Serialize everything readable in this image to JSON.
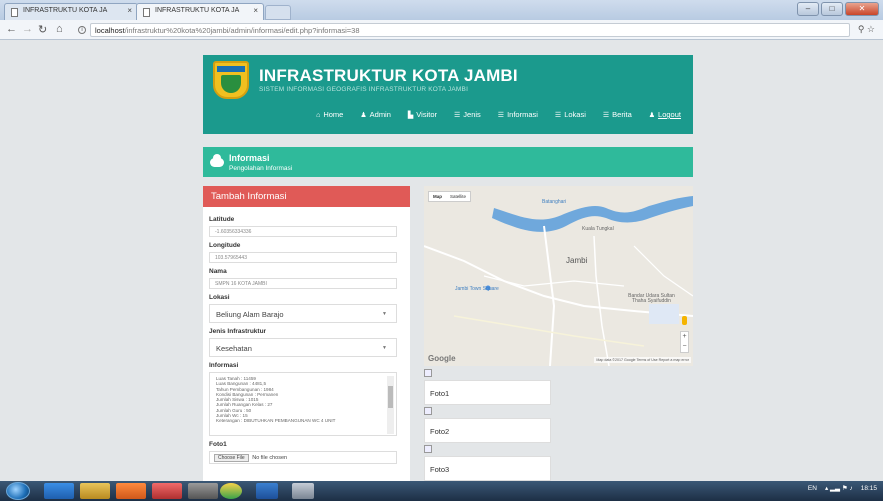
{
  "browser": {
    "tabs": [
      {
        "label": "INFRASTRUKTU KOTA JA",
        "active": false
      },
      {
        "label": "INFRASTRUKTU KOTA JA",
        "active": true
      }
    ],
    "url_host": "localhost",
    "url_path": "/infrastruktur%20kota%20jambi/admin/informasi/edit.php?informasi=38"
  },
  "header": {
    "title": "INFRASTRUKTUR KOTA JAMBI",
    "subtitle": "SISTEM INFORMASI GEOGRAFIS INFRASTRUKTUR KOTA JAMBI",
    "nav": [
      {
        "icon": "home-icon",
        "label": "Home"
      },
      {
        "icon": "user-icon",
        "label": "Admin"
      },
      {
        "icon": "chart-icon",
        "label": "Visitor"
      },
      {
        "icon": "list-icon",
        "label": "Jenis"
      },
      {
        "icon": "list-icon",
        "label": "Informasi"
      },
      {
        "icon": "list-icon",
        "label": "Lokasi"
      },
      {
        "icon": "list-icon",
        "label": "Berita"
      },
      {
        "icon": "user-icon",
        "label": "Logout"
      }
    ]
  },
  "infobar": {
    "title": "Informasi",
    "subtitle": "Pengolahan Informasi"
  },
  "form": {
    "heading": "Tambah Informasi",
    "latitude_label": "Latitude",
    "latitude_value": "-1.60356334336",
    "longitude_label": "Longitude",
    "longitude_value": "103.57965443",
    "nama_label": "Nama",
    "nama_value": "SMPN 16 KOTA JAMBI",
    "lokasi_label": "Lokasi",
    "lokasi_value": "Beliung Alam Barajo",
    "jenis_label": "Jenis Infrastruktur",
    "jenis_value": "Kesehatan",
    "informasi_label": "Informasi",
    "informasi_lines": [
      "Luas Tanah : 11459",
      "Luas Bangunan : 4481,5",
      "Tahun Pembangunan : 1984",
      "Kondisi Bangunan : Permanen",
      "Jumlah Siswa : 1015",
      "Jumlah Ruangan Kelas : 27",
      "Jumlah Guru : 50",
      "Jumlah Wc : 15",
      "Keterangan : DIBUTUHKAN PEMBANGUNAN WC 4 UNIT"
    ],
    "foto1_label": "Foto1",
    "choose_file": "Choose File",
    "no_file": "No file chosen"
  },
  "map": {
    "type_map": "Map",
    "type_satellite": "Satellite",
    "labels": {
      "batanghari": "Batanghari",
      "kuala_tungkal": "Kuala Tungkal",
      "jambi": "Jambi",
      "town_square": "Jambi Town Square",
      "airport": "Bandar Udara Sultan Thaha Syaifuddin"
    },
    "google": "Google",
    "footer": "Map data ©2017 Google   Terms of Use   Report a map error",
    "road_color": "#ffffff",
    "river_color": "#6fa8dc"
  },
  "fotos": [
    "Foto1",
    "Foto2",
    "Foto3"
  ],
  "taskbar": {
    "lang": "EN",
    "time": "18:15"
  }
}
